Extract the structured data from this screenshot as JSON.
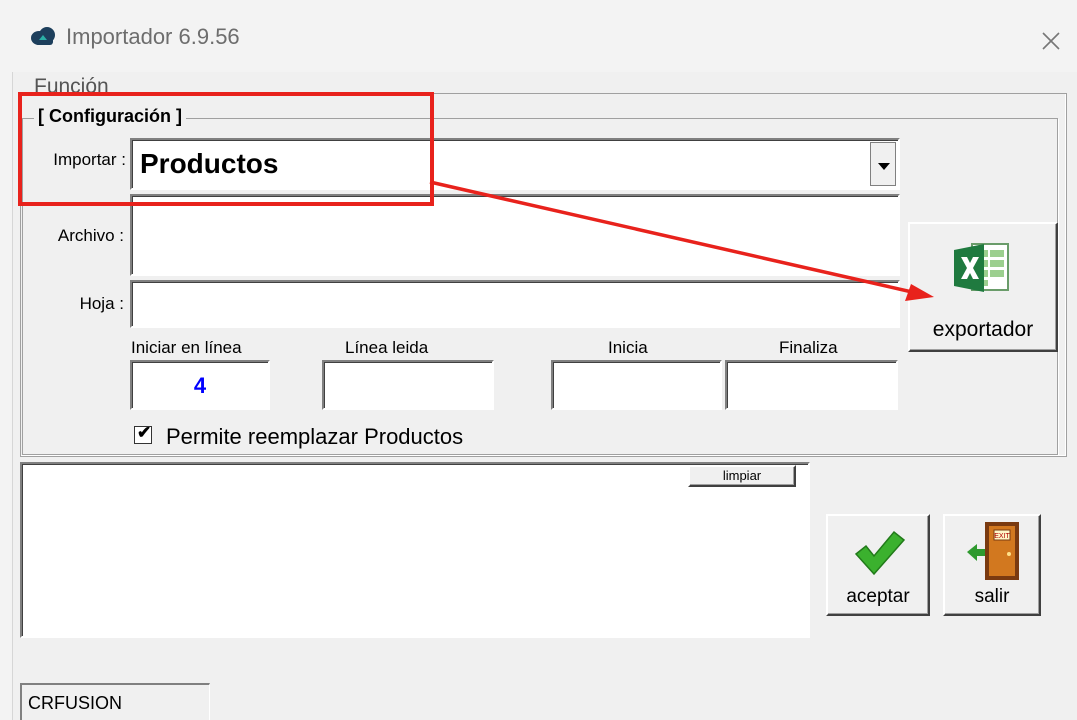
{
  "window": {
    "title": "Importador 6.9.56"
  },
  "menu": {
    "funcion": "Función"
  },
  "config": {
    "legend": "[ Configuración ]",
    "importar_label": "Importar :",
    "importar_value": "Productos",
    "archivo_label": "Archivo :",
    "archivo_value": "",
    "hoja_label": "Hoja :",
    "hoja_value": "",
    "headers": {
      "iniciar": "Iniciar en línea",
      "linea_leida": "Línea leida",
      "inicia": "Inicia",
      "finaliza": "Finaliza"
    },
    "iniciar_value": "4",
    "checkbox_label": "Permite reemplazar Productos",
    "checkbox_checked": true
  },
  "buttons": {
    "exportador": "exportador",
    "limpiar": "limpiar",
    "aceptar": "aceptar",
    "salir": "salir"
  },
  "status": {
    "text": "CRFUSION"
  },
  "icons": [
    "cloud-app-icon",
    "close-icon",
    "excel-icon",
    "checkmark-icon",
    "exit-door-icon",
    "chevron-down-icon"
  ],
  "colors": {
    "annotation": "#e8221c",
    "accent_value": "#0000ff"
  }
}
